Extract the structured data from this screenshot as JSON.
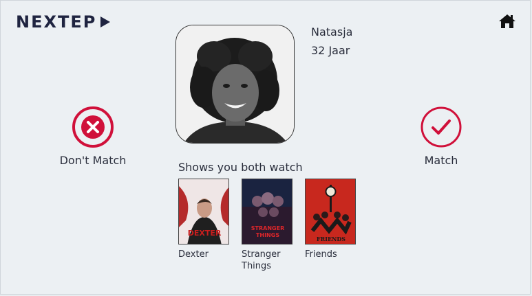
{
  "header": {
    "logo_text": "NEXTEP",
    "logo_icon": "play-triangle-icon",
    "home_icon": "home-icon"
  },
  "profile": {
    "name": "Natasja",
    "age": "32 Jaar",
    "photo_icon": "profile-photo"
  },
  "actions": {
    "dont_match_label": "Don't Match",
    "match_label": "Match",
    "accent_color": "#d0103a"
  },
  "shows": {
    "title": "Shows you both watch",
    "items": [
      {
        "title": "Dexter",
        "poster_lines": [
          "DEXTER"
        ]
      },
      {
        "title": "Stranger Things",
        "poster_lines": [
          "STRANGER",
          "THINGS"
        ]
      },
      {
        "title": "Friends",
        "poster_lines": [
          "FRIENDS"
        ]
      }
    ]
  }
}
